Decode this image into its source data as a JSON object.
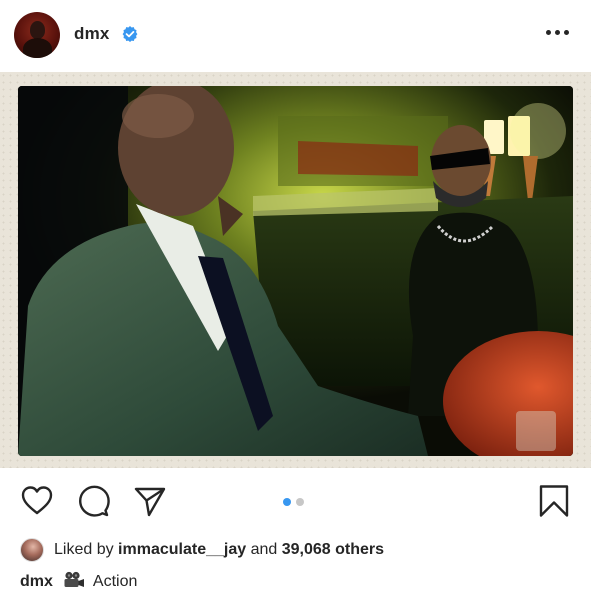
{
  "post": {
    "username": "dmx",
    "verified": true,
    "menu_icon": "more-dots-icon"
  },
  "photo": {
    "description_icon": "photo",
    "carousel": {
      "total": 2,
      "active_index": 0,
      "active_color": "#3897f0",
      "inactive_color": "#c7c7c7"
    }
  },
  "actions": {
    "like_icon": "heart-icon",
    "comment_icon": "comment-icon",
    "share_icon": "send-icon",
    "save_icon": "bookmark-icon"
  },
  "likes": {
    "prefix": "Liked by",
    "user": "immaculate__jay",
    "middle": "and",
    "count": "39,068 others"
  },
  "caption": {
    "username": "dmx",
    "emoji_icon": "movie-camera-icon",
    "text": "Action"
  },
  "colors": {
    "verified_blue": "#3897f0",
    "text": "#262626"
  }
}
